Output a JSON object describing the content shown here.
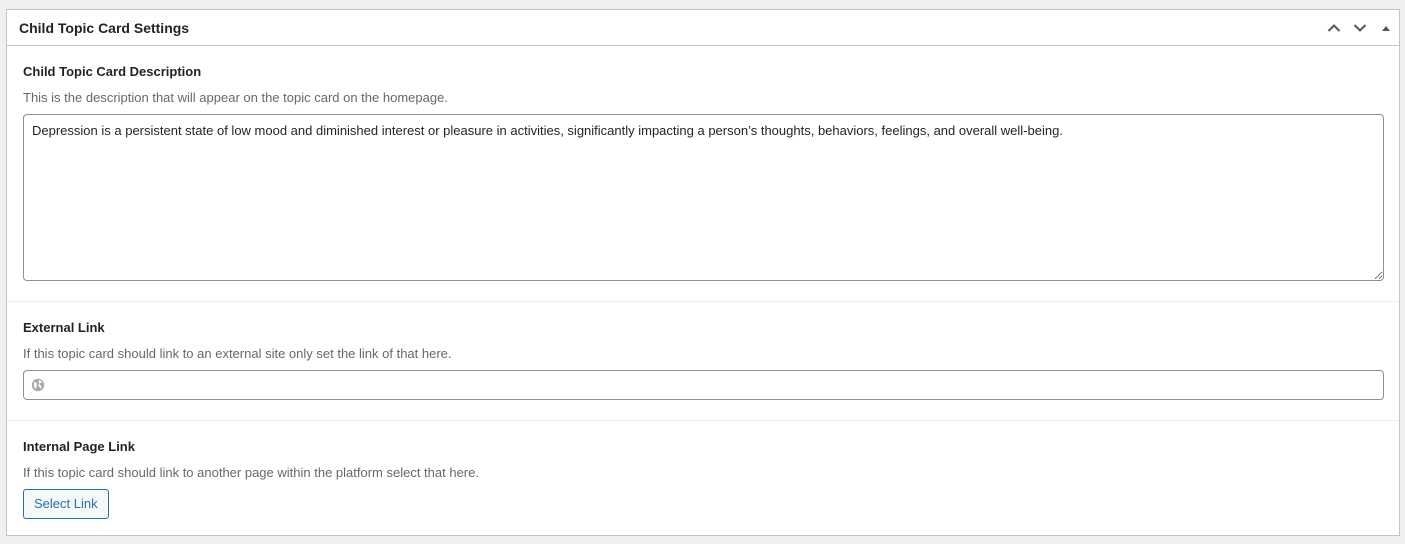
{
  "panel": {
    "title": "Child Topic Card Settings",
    "controls": {
      "move_up_icon": "chevron-up-icon",
      "move_down_icon": "chevron-down-icon",
      "toggle_icon": "triangle-up-icon"
    }
  },
  "description_field": {
    "label": "Child Topic Card Description",
    "help": "This is the description that will appear on the topic card on the homepage.",
    "value": "Depression is a persistent state of low mood and diminished interest or pleasure in activities, significantly impacting a person’s thoughts, behaviors, feelings, and overall well-being."
  },
  "external_link_field": {
    "label": "External Link",
    "help": "If this topic card should link to an external site only set the link of that here.",
    "value": "",
    "icon": "globe-icon"
  },
  "internal_link_field": {
    "label": "Internal Page Link",
    "help": "If this topic card should link to another page within the platform select that here.",
    "button_label": "Select Link"
  },
  "colors": {
    "accent": "#2271b1",
    "border": "#c3c4c7",
    "muted_text": "#646970"
  }
}
